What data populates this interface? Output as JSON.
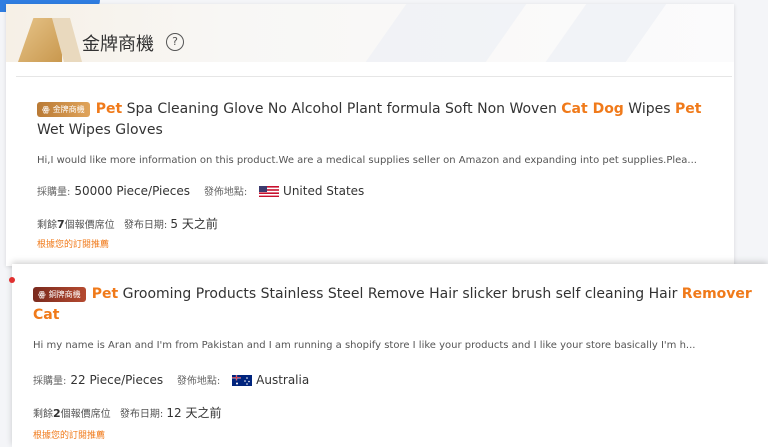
{
  "section": {
    "title": "金牌商機",
    "info_symbol": "?"
  },
  "listings": [
    {
      "badge": "金牌商機",
      "title_parts": [
        {
          "text": "Pet",
          "hl": true
        },
        {
          "text": " Spa Cleaning Glove No Alcohol Plant formula Soft Non Woven ",
          "hl": false
        },
        {
          "text": "Cat Dog",
          "hl": true
        },
        {
          "text": " Wipes ",
          "hl": false
        },
        {
          "text": "Pet",
          "hl": true
        },
        {
          "text": " Wet Wipes Gloves",
          "hl": false
        }
      ],
      "description": "Hi,I would like more information on this product.We are a medical supplies seller on Amazon and expanding into pet supplies.Plea...",
      "qty_label": "採購量:",
      "qty_value": "50000 Piece/Pieces",
      "dest_label": "發佈地點:",
      "country": "United States",
      "remaining_prefix": "剩餘",
      "remaining_count": "7",
      "remaining_suffix": "個報價席位",
      "date_label": "發布日期:",
      "date_value": "5 天之前",
      "recommend": "根據您的訂閱推薦"
    },
    {
      "badge": "銅牌商機",
      "title_parts": [
        {
          "text": "Pet",
          "hl": true
        },
        {
          "text": " Grooming Products Stainless Steel Remove Hair slicker brush self cleaning Hair ",
          "hl": false
        },
        {
          "text": "Remover Cat",
          "hl": true
        }
      ],
      "description": "Hi my name is Aran and I'm from Pakistan and I am running a shopify store I like your products and I like your store basically I'm h...",
      "qty_label": "採購量:",
      "qty_value": "22 Piece/Pieces",
      "dest_label": "發佈地點:",
      "country": "Australia",
      "remaining_prefix": "剩餘",
      "remaining_count": "2",
      "remaining_suffix": "個報價席位",
      "date_label": "發布日期:",
      "date_value": "12 天之前",
      "recommend": "根據您的訂閱推薦"
    }
  ],
  "colors": {
    "highlight": "#f07a1a",
    "gold_badge": "#c98a42",
    "bronze_badge": "#9a3a26",
    "tab": "#2f7de1"
  }
}
